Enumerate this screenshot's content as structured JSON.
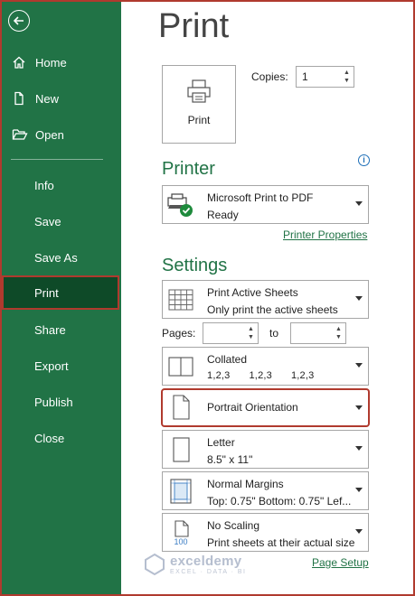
{
  "sidebar": {
    "items": [
      {
        "label": "Home",
        "icon": "home-icon"
      },
      {
        "label": "New",
        "icon": "new-document-icon"
      },
      {
        "label": "Open",
        "icon": "folder-open-icon"
      },
      {
        "label": "Info"
      },
      {
        "label": "Save"
      },
      {
        "label": "Save As"
      },
      {
        "label": "Print",
        "active": true
      },
      {
        "label": "Share"
      },
      {
        "label": "Export"
      },
      {
        "label": "Publish"
      },
      {
        "label": "Close"
      }
    ],
    "background": "#217346",
    "active_background": "#0e4a28"
  },
  "main": {
    "title": "Print",
    "print_button_label": "Print",
    "copies_label": "Copies:",
    "copies_value": "1",
    "printer_section": "Printer",
    "printer": {
      "name": "Microsoft Print to PDF",
      "status": "Ready"
    },
    "printer_properties_link": "Printer Properties",
    "settings_section": "Settings",
    "print_what": {
      "line1": "Print Active Sheets",
      "line2": "Only print the active sheets"
    },
    "pages_label": "Pages:",
    "to_label": "to",
    "pages_from": "",
    "pages_to": "",
    "collation": {
      "line1": "Collated",
      "line2": "1,2,3    1,2,3    1,2,3"
    },
    "orientation": {
      "line1": "Portrait Orientation"
    },
    "paper": {
      "line1": "Letter",
      "line2": "8.5\" x 11\""
    },
    "margins": {
      "line1": "Normal Margins",
      "line2": "Top: 0.75\" Bottom: 0.75\" Lef..."
    },
    "scaling": {
      "line1": "No Scaling",
      "line2": "Print sheets at their actual size",
      "icon_text": "100"
    },
    "page_setup_link": "Page Setup"
  },
  "watermark": {
    "name": "exceldemy",
    "tagline": "EXCEL · DATA · BI"
  },
  "colors": {
    "accent": "#217346",
    "highlight_border": "#b03a2e",
    "info": "#1e6fb8"
  }
}
